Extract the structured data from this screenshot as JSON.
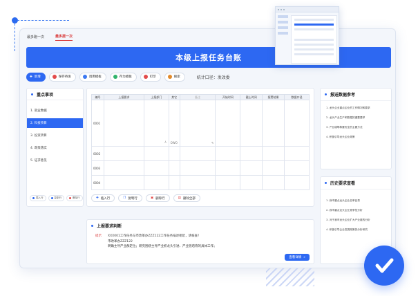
{
  "tabs": [
    "最多跑一次",
    "最多报一次"
  ],
  "active_tab": 1,
  "banner_title": "本级上报任务台账",
  "toolbar": {
    "buttons": [
      {
        "label": "新增",
        "icon": "plus-icon",
        "primary": true
      },
      {
        "label": "保存待发",
        "icon": "save-icon"
      },
      {
        "label": "调用模板",
        "icon": "template-icon"
      },
      {
        "label": "存为模板",
        "icon": "store-template-icon"
      },
      {
        "label": "打印",
        "icon": "print-icon"
      },
      {
        "label": "搜索",
        "icon": "search-icon"
      }
    ],
    "meta": "统计口径：发改委"
  },
  "left_panel": {
    "title": "重点事项",
    "items": [
      "1. 就业数据",
      "2. 科技项目",
      "3. 投资项目",
      "4. 政策落实",
      "5. 证求意见"
    ],
    "active_index": 1,
    "actions": [
      "插入行",
      "复制行",
      "删除行"
    ]
  },
  "table": {
    "headers": [
      "编号",
      "上报要求",
      "上报部门",
      "其它",
      "备注",
      "开始时间",
      "截止时间",
      "报警结果",
      "数据口径"
    ],
    "rows": [
      "0001",
      "0002",
      "0003",
      "0004"
    ],
    "row1_cell_marks": [
      "人",
      "OWO",
      "✎"
    ],
    "actions": [
      {
        "label": "插入行",
        "icon": "plus-icon"
      },
      {
        "label": "复制行",
        "icon": "copy-icon"
      },
      {
        "label": "删除行",
        "icon": "delete-icon"
      },
      {
        "label": "删除全部",
        "icon": "clear-icon"
      }
    ]
  },
  "right_top": {
    "title": "报送数据参考",
    "items": [
      "1. 龙头企业重点企业的工作情况和要求",
      "2. 龙头产业生产和数据的重要要求",
      "3. 产业增等和要安全的主要方法",
      "4. 积极引导龙头企业政策"
    ]
  },
  "right_bottom": {
    "title": "历史要求查看",
    "items": [
      "1. 我市重点龙头企业名单目录",
      "2. 我市重点龙头企业竞争性分析",
      "3. 对于我市龙头企业扩大产业链的分析",
      "4. 积极引导企业发展政策的分析研究"
    ]
  },
  "requirement": {
    "title": "上报要求判断",
    "label": "提示",
    "line1": "XXX001工作任务与市改革办ZZZ122工作任务描述相近，请核查！",
    "line2": "市改革办ZZZ122",
    "line3": "明确主导产业群定位；研究围绕主导产业抓龙头引进、产业链培育的具体工作；",
    "button": "查看详情"
  },
  "colors": {
    "accent": "#2d68f2",
    "alert": "#d93b3b"
  }
}
